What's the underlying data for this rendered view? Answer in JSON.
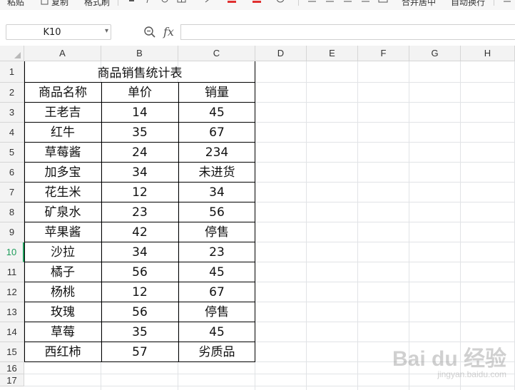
{
  "toolbar": {
    "items": [
      "粘贴",
      "复制",
      "格式刷",
      "合并居中",
      "自动换行"
    ]
  },
  "formula_bar": {
    "name_box": "K10",
    "fx_label": "fx",
    "formula_value": ""
  },
  "sheet": {
    "columns": [
      "A",
      "B",
      "C",
      "D",
      "E",
      "F",
      "G",
      "H"
    ],
    "rows": [
      "1",
      "2",
      "3",
      "4",
      "5",
      "6",
      "7",
      "8",
      "9",
      "10",
      "11",
      "12",
      "13",
      "14",
      "15",
      "16",
      "17"
    ],
    "active_row": "10",
    "title": "商品销售统计表",
    "headers": [
      "商品名称",
      "单价",
      "销量"
    ],
    "data": [
      [
        "王老吉",
        "14",
        "45"
      ],
      [
        "红牛",
        "35",
        "67"
      ],
      [
        "草莓酱",
        "24",
        "234"
      ],
      [
        "加多宝",
        "34",
        "未进货"
      ],
      [
        "花生米",
        "12",
        "34"
      ],
      [
        "矿泉水",
        "23",
        "56"
      ],
      [
        "苹果酱",
        "42",
        "停售"
      ],
      [
        "沙拉",
        "34",
        "23"
      ],
      [
        "橘子",
        "56",
        "45"
      ],
      [
        "杨桃",
        "12",
        "67"
      ],
      [
        "玫瑰",
        "56",
        "停售"
      ],
      [
        "草莓",
        "35",
        "45"
      ],
      [
        "西红柿",
        "57",
        "劣质品"
      ]
    ]
  },
  "watermark": {
    "text": "Bai du 经验",
    "sub": "jingyan.baidu.com"
  },
  "colors": {
    "active_row_accent": "#1e9c5a",
    "gridline": "#e1e3e6",
    "header_bg": "#f3f3f3"
  }
}
